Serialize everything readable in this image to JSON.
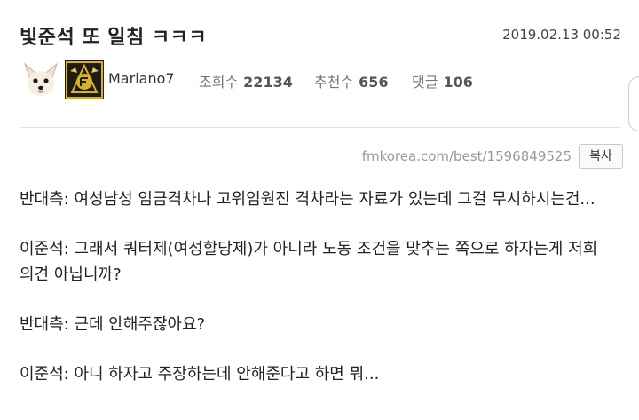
{
  "post": {
    "title": "빛준석 또 일침 ㅋㅋㅋ",
    "date": "2019.02.13 00:52",
    "author": {
      "nickname": "Mariano7",
      "avatar_icon": "dog-face-icon",
      "level_icon": "gold-crest-level-icon"
    },
    "stats": {
      "views_label": "조회수",
      "views": "22134",
      "votes_label": "추천수",
      "votes": "656",
      "comments_label": "댓글",
      "comments": "106"
    },
    "url": "fmkorea.com/best/1596849525",
    "copy_label": "복사",
    "body": [
      "반대측: 여성남성 임금격차나 고위임원진 격차라는 자료가 있는데 그걸 무시하시는건...",
      "이준석: 그래서 쿼터제(여성할당제)가 아니라 노동 조건을 맞추는 쪽으로 하자는게 저희 의견 아닙니까?",
      "반대측: 근데 안해주잖아요?",
      "이준석: 아니 하자고 주장하는데 안해준다고 하면 뭐..."
    ]
  },
  "colors": {
    "text": "#222222",
    "muted": "#999999",
    "divider": "#e3e3e3",
    "badge_gold": "#d9b21f"
  }
}
